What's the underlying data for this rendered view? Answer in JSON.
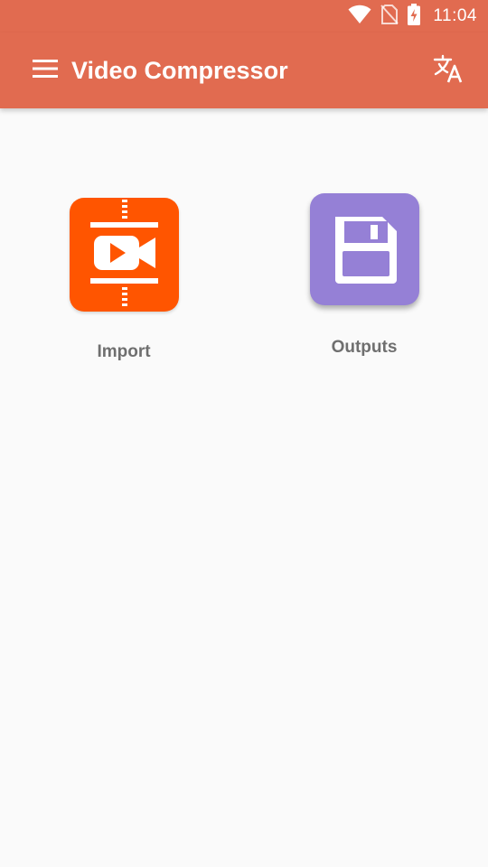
{
  "status_bar": {
    "time": "11:04",
    "icons": [
      "wifi-icon",
      "no-sim-icon",
      "battery-charging-icon"
    ]
  },
  "app_bar": {
    "title": "Video Compressor",
    "menu_icon": "hamburger-menu-icon",
    "translate_icon": "translate-icon",
    "color": "#e16b50"
  },
  "tiles": [
    {
      "label": "Import",
      "icon": "video-compress-icon",
      "color": "#ff5500"
    },
    {
      "label": "Outputs",
      "icon": "floppy-save-icon",
      "color": "#9580d6"
    }
  ]
}
